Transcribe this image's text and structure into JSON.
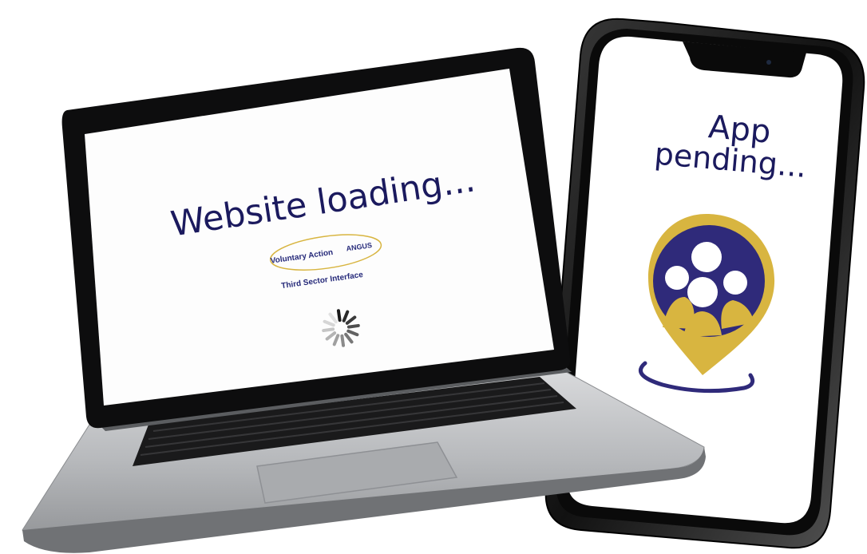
{
  "laptop": {
    "headline": "Website loading...",
    "logo": {
      "line1": "Voluntary Action",
      "line1_suffix": "ANGUS",
      "line2": "Third Sector Interface"
    }
  },
  "phone": {
    "line1": "App",
    "line2": "pending..."
  },
  "colors": {
    "brand_navy": "#2f2a7a",
    "brand_gold": "#d8b540",
    "text_navy": "#1b1a5e"
  },
  "icons": {
    "spinner": "loading-spinner-icon",
    "app_logo": "location-pin-people-icon"
  }
}
